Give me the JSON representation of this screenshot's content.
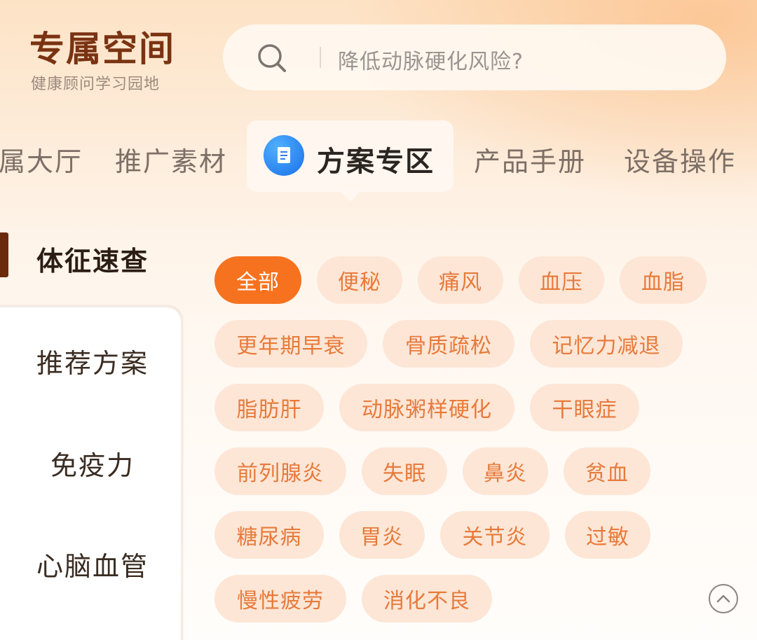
{
  "header": {
    "title": "专属空间",
    "subtitle": "健康顾问学习园地"
  },
  "search": {
    "placeholder": "降低动脉硬化风险?"
  },
  "tabs": [
    {
      "label": "属大厅"
    },
    {
      "label": "推广素材"
    },
    {
      "label": "方案专区",
      "active": true
    },
    {
      "label": "产品手册"
    },
    {
      "label": "设备操作"
    }
  ],
  "sidebar": {
    "items": [
      {
        "label": "体征速查",
        "active": true
      },
      {
        "label": "推荐方案"
      },
      {
        "label": "免疫力"
      },
      {
        "label": "心脑血管"
      }
    ]
  },
  "chips": [
    {
      "label": "全部",
      "active": true
    },
    {
      "label": "便秘"
    },
    {
      "label": "痛风"
    },
    {
      "label": "血压"
    },
    {
      "label": "血脂"
    },
    {
      "label": "更年期早衰"
    },
    {
      "label": "骨质疏松"
    },
    {
      "label": "记忆力减退"
    },
    {
      "label": "脂肪肝"
    },
    {
      "label": "动脉粥样硬化"
    },
    {
      "label": "干眼症"
    },
    {
      "label": "前列腺炎"
    },
    {
      "label": "失眠"
    },
    {
      "label": "鼻炎"
    },
    {
      "label": "贫血"
    },
    {
      "label": "糖尿病"
    },
    {
      "label": "胃炎"
    },
    {
      "label": "关节炎"
    },
    {
      "label": "过敏"
    },
    {
      "label": "慢性疲劳"
    },
    {
      "label": "消化不良"
    }
  ],
  "colors": {
    "brand": "#7a3312",
    "accent": "#f6721f",
    "chip_bg": "#fde6d6",
    "chip_text": "#e77a3a"
  },
  "icons": {
    "search": "search-icon",
    "active_tab": "document-icon",
    "scroll_top": "chevron-up-icon"
  }
}
